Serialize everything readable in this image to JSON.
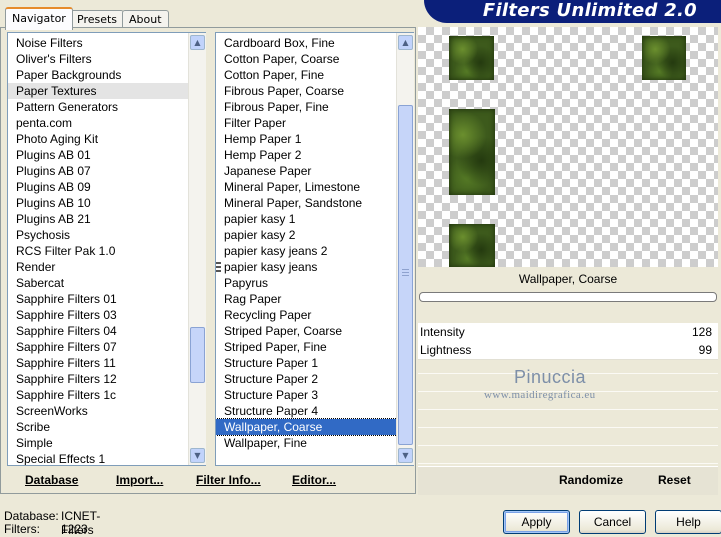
{
  "tabs": [
    "Navigator",
    "Presets",
    "About"
  ],
  "app_title": "Filters Unlimited 2.0",
  "category_list": {
    "items": [
      "Noise Filters",
      "Oliver's Filters",
      "Paper Backgrounds",
      "Paper Textures",
      "Pattern Generators",
      "penta.com",
      "Photo Aging Kit",
      "Plugins AB 01",
      "Plugins AB 07",
      "Plugins AB 09",
      "Plugins AB 10",
      "Plugins AB 21",
      "Psychosis",
      "RCS Filter Pak 1.0",
      "Render",
      "Sabercat",
      "Sapphire Filters 01",
      "Sapphire Filters 03",
      "Sapphire Filters 04",
      "Sapphire Filters 07",
      "Sapphire Filters 11",
      "Sapphire Filters 12",
      "Sapphire Filters 1c",
      "ScreenWorks",
      "Scribe",
      "Simple",
      "Special Effects 1"
    ],
    "selected": "Paper Textures"
  },
  "filter_list": {
    "items": [
      "Cardboard Box, Fine",
      "Cotton Paper, Coarse",
      "Cotton Paper, Fine",
      "Fibrous Paper, Coarse",
      "Fibrous Paper, Fine",
      "Filter Paper",
      "Hemp Paper 1",
      "Hemp Paper 2",
      "Japanese Paper",
      "Mineral Paper, Limestone",
      "Mineral Paper, Sandstone",
      "papier kasy 1",
      "papier kasy 2",
      "papier kasy jeans 2",
      "papier kasy jeans",
      "Papyrus",
      "Rag Paper",
      "Recycling Paper",
      "Striped Paper, Coarse",
      "Striped Paper, Fine",
      "Structure Paper 1",
      "Structure Paper 2",
      "Structure Paper 3",
      "Structure Paper 4",
      "Wallpaper, Coarse",
      "Wallpaper, Fine"
    ],
    "selected": "Wallpaper, Coarse"
  },
  "toolbar": {
    "database": "Database",
    "import": "Import...",
    "filter_info": "Filter Info...",
    "editor": "Editor..."
  },
  "preview": {
    "filter_name": "Wallpaper, Coarse"
  },
  "params": [
    {
      "label": "Intensity",
      "value": "128"
    },
    {
      "label": "Lightness",
      "value": "99"
    }
  ],
  "watermark": {
    "line1": "Pinuccia",
    "line2": "www.maidiregrafica.eu"
  },
  "right_buttons": {
    "randomize": "Randomize",
    "reset": "Reset"
  },
  "status": {
    "database_label": "Database:",
    "database_value": "ICNET-Filters",
    "filters_label": "Filters:",
    "filters_value": "1223"
  },
  "dialog_buttons": {
    "apply": "Apply",
    "cancel": "Cancel",
    "help": "Help"
  },
  "colors": {
    "selection_blue": "#316ac5",
    "banner": "#0b1f7a",
    "window_bg": "#ece9d8"
  }
}
